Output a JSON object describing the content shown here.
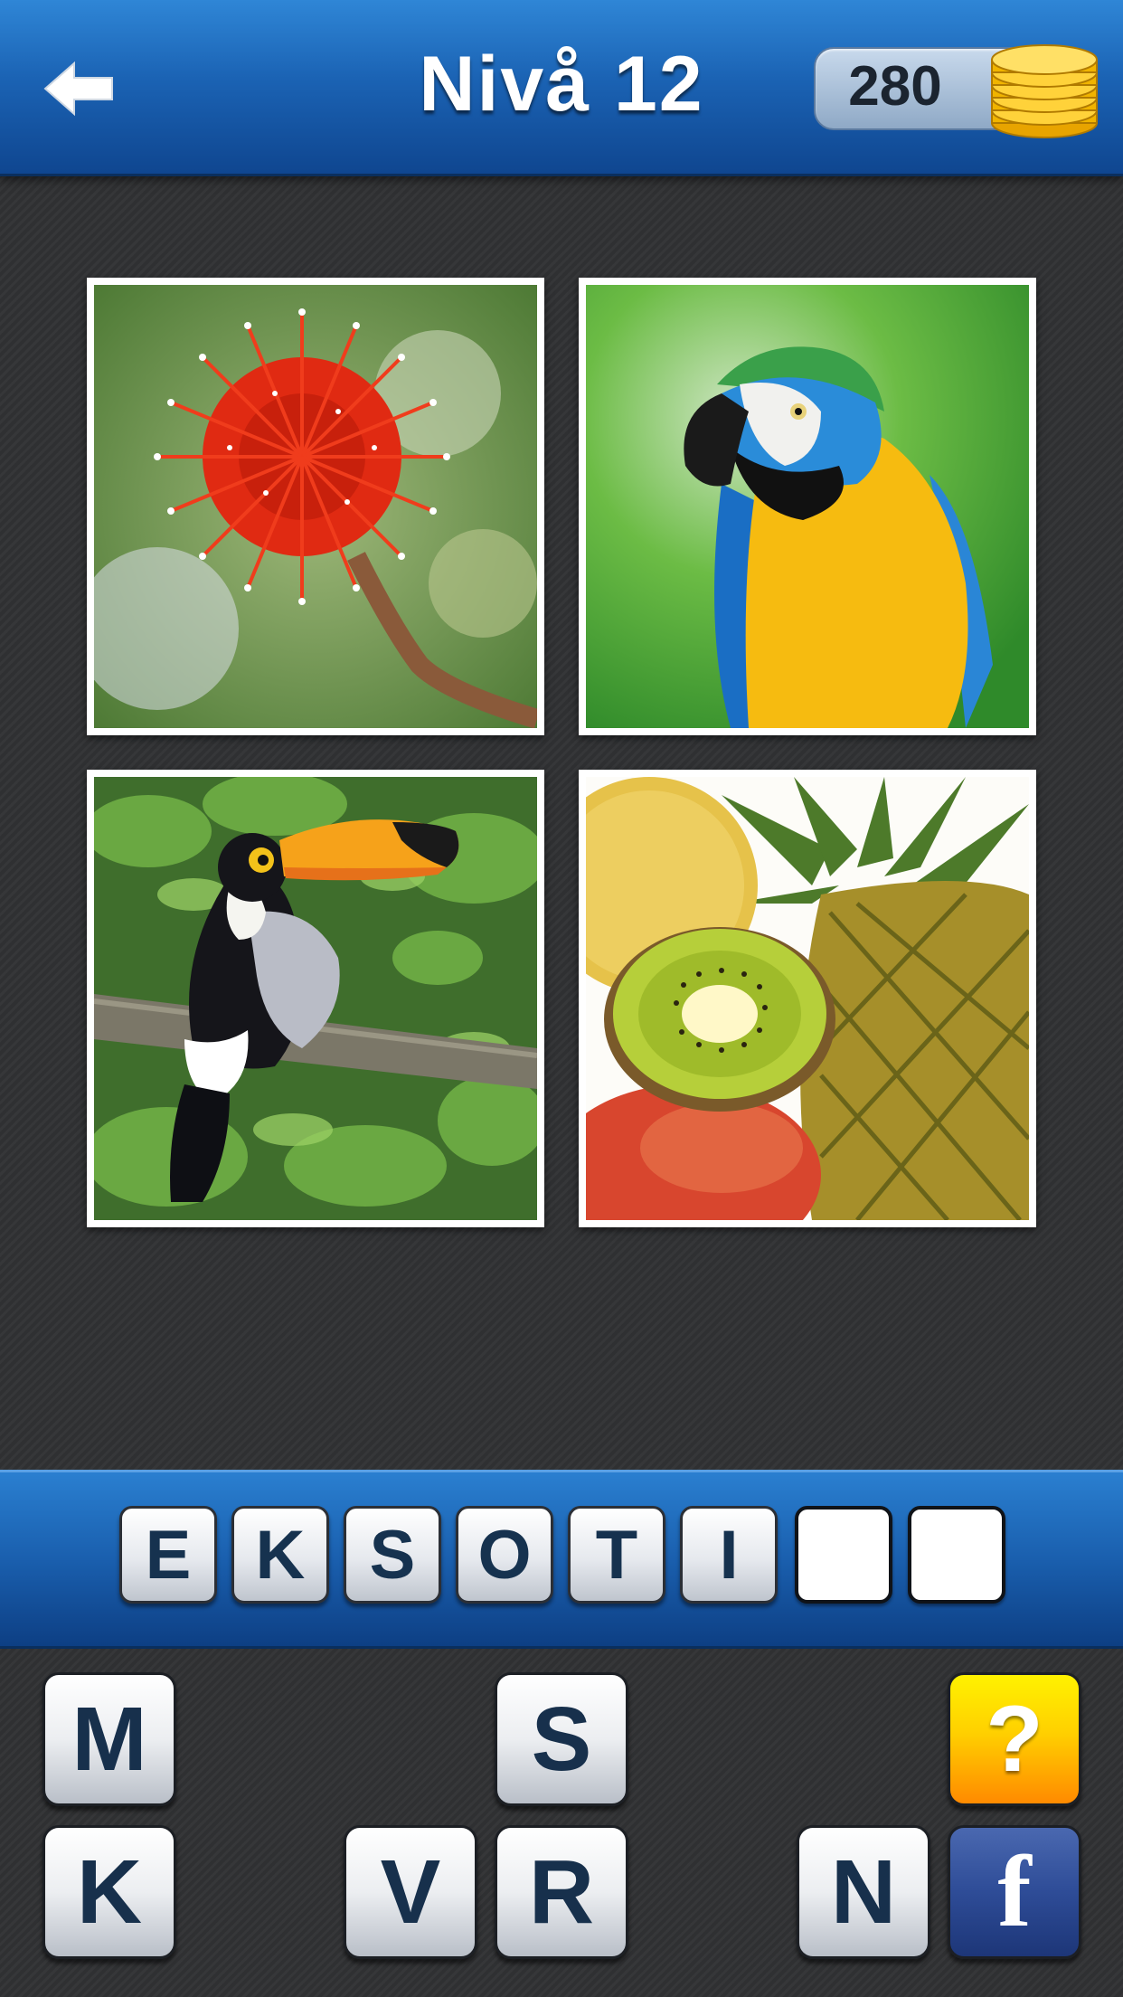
{
  "header": {
    "back_icon": "left-arrow-icon",
    "level_title": "Nivå 12",
    "coins": "280",
    "coin_icon": "coin-stack-icon"
  },
  "pictures": [
    {
      "name": "red-flower",
      "description_icon": "flower-photo"
    },
    {
      "name": "macaw-parrot",
      "description_icon": "parrot-photo"
    },
    {
      "name": "toucan",
      "description_icon": "toucan-photo"
    },
    {
      "name": "tropical-fruits",
      "description_icon": "fruit-photo"
    }
  ],
  "answer": {
    "letters": [
      "E",
      "K",
      "S",
      "O",
      "T",
      "I",
      "",
      ""
    ]
  },
  "keyboard": {
    "row1": [
      "M",
      "S"
    ],
    "row2": [
      "K",
      "V",
      "R",
      "N"
    ],
    "hint_label": "?",
    "facebook_label": "f"
  },
  "colors": {
    "header_blue": "#1b63b4",
    "hint_yellow": "#ffd000",
    "facebook_blue": "#2e4c97"
  }
}
